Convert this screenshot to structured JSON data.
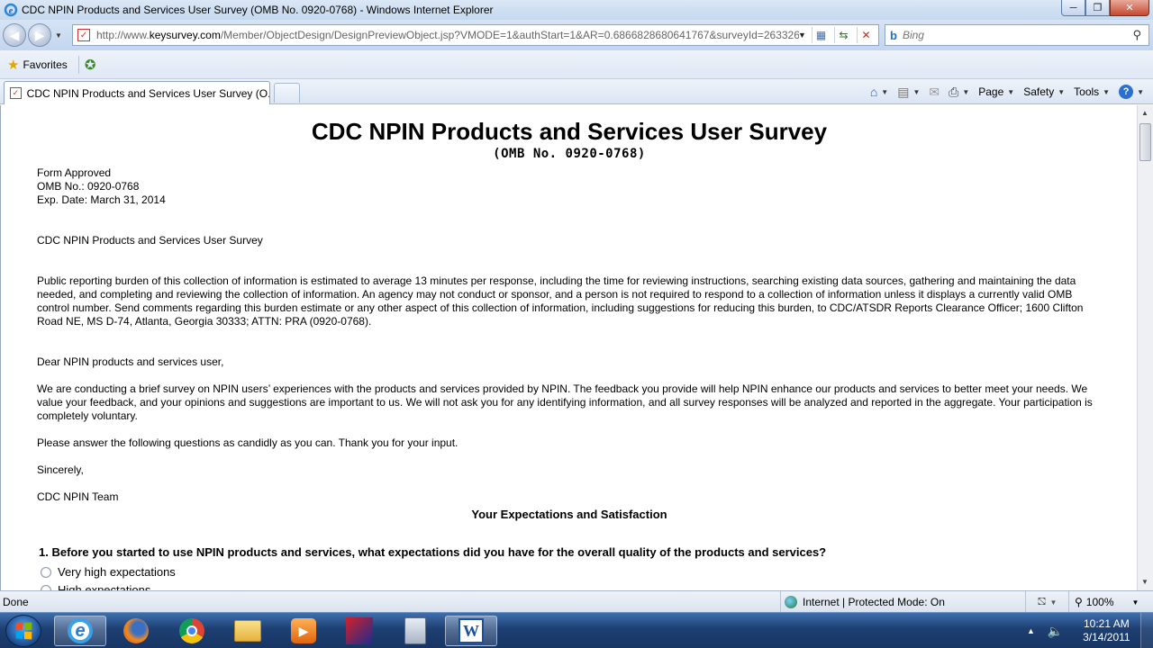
{
  "window": {
    "title": "CDC NPIN Products and Services User Survey (OMB No. 0920-0768) - Windows Internet Explorer",
    "min_icon": "minimize-icon",
    "max_icon": "maximize-icon",
    "close_icon": "close-icon"
  },
  "nav": {
    "url_prefix": "http://www.",
    "url_domain": "keysurvey.com",
    "url_rest": "/Member/ObjectDesign/DesignPreviewObject.jsp?VMODE=1&authStart=1&AR=0.6866828680641767&surveyId=263326",
    "search_placeholder": "Bing"
  },
  "favorites": {
    "label": "Favorites"
  },
  "tab": {
    "label": "CDC NPIN Products and Services User Survey (O..."
  },
  "commands": {
    "page": "Page",
    "safety": "Safety",
    "tools": "Tools"
  },
  "content": {
    "title": "CDC NPIN Products and Services User Survey",
    "subtitle": "(OMB No. 0920-0768)",
    "form_lines": [
      "Form Approved",
      "OMB No.: 0920-0768",
      "Exp. Date: March 31, 2014"
    ],
    "survey_name": "CDC NPIN Products and Services User Survey",
    "burden": "Public reporting burden of this collection of information is estimated to average 13 minutes per response, including the time for reviewing instructions, searching existing data sources, gathering and maintaining the data needed, and completing and reviewing the collection of information. An agency may not conduct or sponsor, and a person is not required to respond to a collection of information unless it displays a currently valid OMB control number. Send comments regarding this burden estimate or any other aspect of this collection of information, including suggestions for reducing this burden, to CDC/ATSDR Reports Clearance Officer; 1600 Clifton Road NE, MS D-74, Atlanta, Georgia 30333; ATTN: PRA (0920-0768).",
    "greeting": "Dear NPIN products and services user,",
    "intro": "We are conducting a brief survey on NPIN users’ experiences with the products and services provided by NPIN. The feedback you provide will help NPIN enhance our products and services to better meet your needs. We value your feedback, and your opinions and suggestions are important to us. We will not ask you for any identifying information, and all survey responses will be analyzed and reported in the aggregate. Your participation is completely voluntary.",
    "please": "Please answer the following questions as candidly as you can. Thank you for your input.",
    "sincerely": "Sincerely,",
    "team": "CDC NPIN Team",
    "section": "Your Expectations and Satisfaction",
    "q1": "1. Before you started to use NPIN products and services, what expectations did you have for the overall quality of the products and services?",
    "q1_options": [
      "Very high expectations",
      "High expectations"
    ]
  },
  "status": {
    "done": "Done",
    "zone": "Internet | Protected Mode: On",
    "zoom": "100%"
  },
  "taskbar": {
    "time": "10:21 AM",
    "date": "3/14/2011",
    "word_letter": "W"
  }
}
